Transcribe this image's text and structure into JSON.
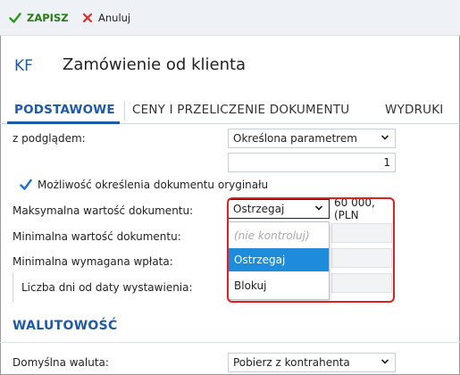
{
  "toolbar": {
    "save_label": "ZAPISZ",
    "cancel_label": "Anuluj"
  },
  "header": {
    "badge": "KF",
    "title": "Zamówienie od klienta"
  },
  "tabs": [
    {
      "label": "PODSTAWOWE",
      "active": true
    },
    {
      "label": "CENY I PRZELICZENIE DOKUMENTU",
      "active": false
    },
    {
      "label": "WYDRUKI",
      "active": false
    }
  ],
  "form": {
    "preview_label": "z podglądem:",
    "preview_select": "Określona parametrem",
    "copies_value": "1",
    "original_checkbox_label": "Możliwość określenia dokumentu oryginału",
    "original_checked": true,
    "max_value_label": "Maksymalna wartość dokumentu:",
    "max_value_select": "Ostrzegaj",
    "max_value_amount": "60 000,(PLN",
    "min_value_label": "Minimalna wartość dokumentu:",
    "min_payment_label": "Minimalna wymagana wpłata:",
    "days_label": "Liczba dni od daty wystawienia:"
  },
  "dropdown": {
    "options": [
      {
        "label": "(nie kontroluj)",
        "placeholder": true
      },
      {
        "label": "Ostrzegaj",
        "selected": true
      },
      {
        "label": "Blokuj"
      }
    ]
  },
  "currency_section": {
    "title": "WALUTOWOŚĆ",
    "default_currency_label": "Domyślna waluta:",
    "default_currency_select": "Pobierz z kontrahenta"
  },
  "colors": {
    "accent": "#1e5aa8",
    "save_green": "#2a7a17",
    "cancel_red": "#d9302a",
    "highlight_red": "#e02020",
    "selected_blue": "#1e8bdb"
  }
}
